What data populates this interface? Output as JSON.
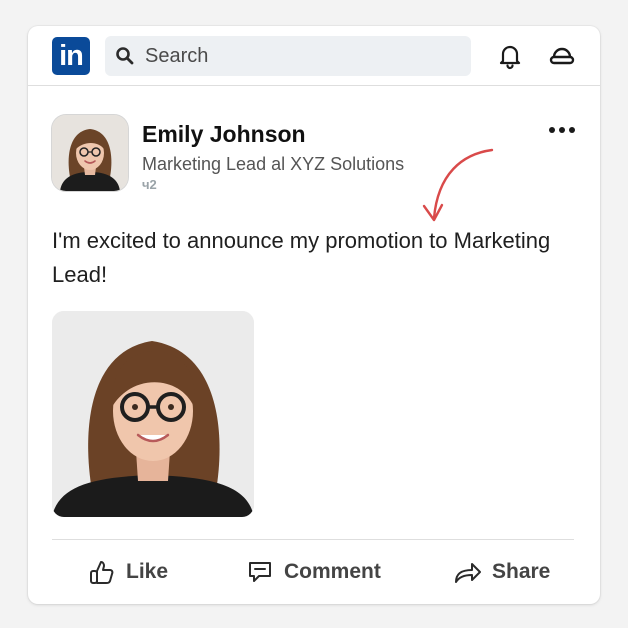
{
  "header": {
    "logo_text": "in",
    "search_placeholder": "Search",
    "icons": [
      "search-icon",
      "bell-icon",
      "cap-icon"
    ],
    "brand_color": "#0a4a99"
  },
  "post": {
    "author": {
      "name": "Emily Johnson",
      "title": "Marketing Lead al XYZ Solutions",
      "time": "ч2"
    },
    "text": "I'm excited to announce my promotion to Marketing Lead!",
    "annotation_color": "#d94a4a"
  },
  "actions": {
    "like": "Like",
    "comment": "Comment",
    "share": "Share"
  }
}
